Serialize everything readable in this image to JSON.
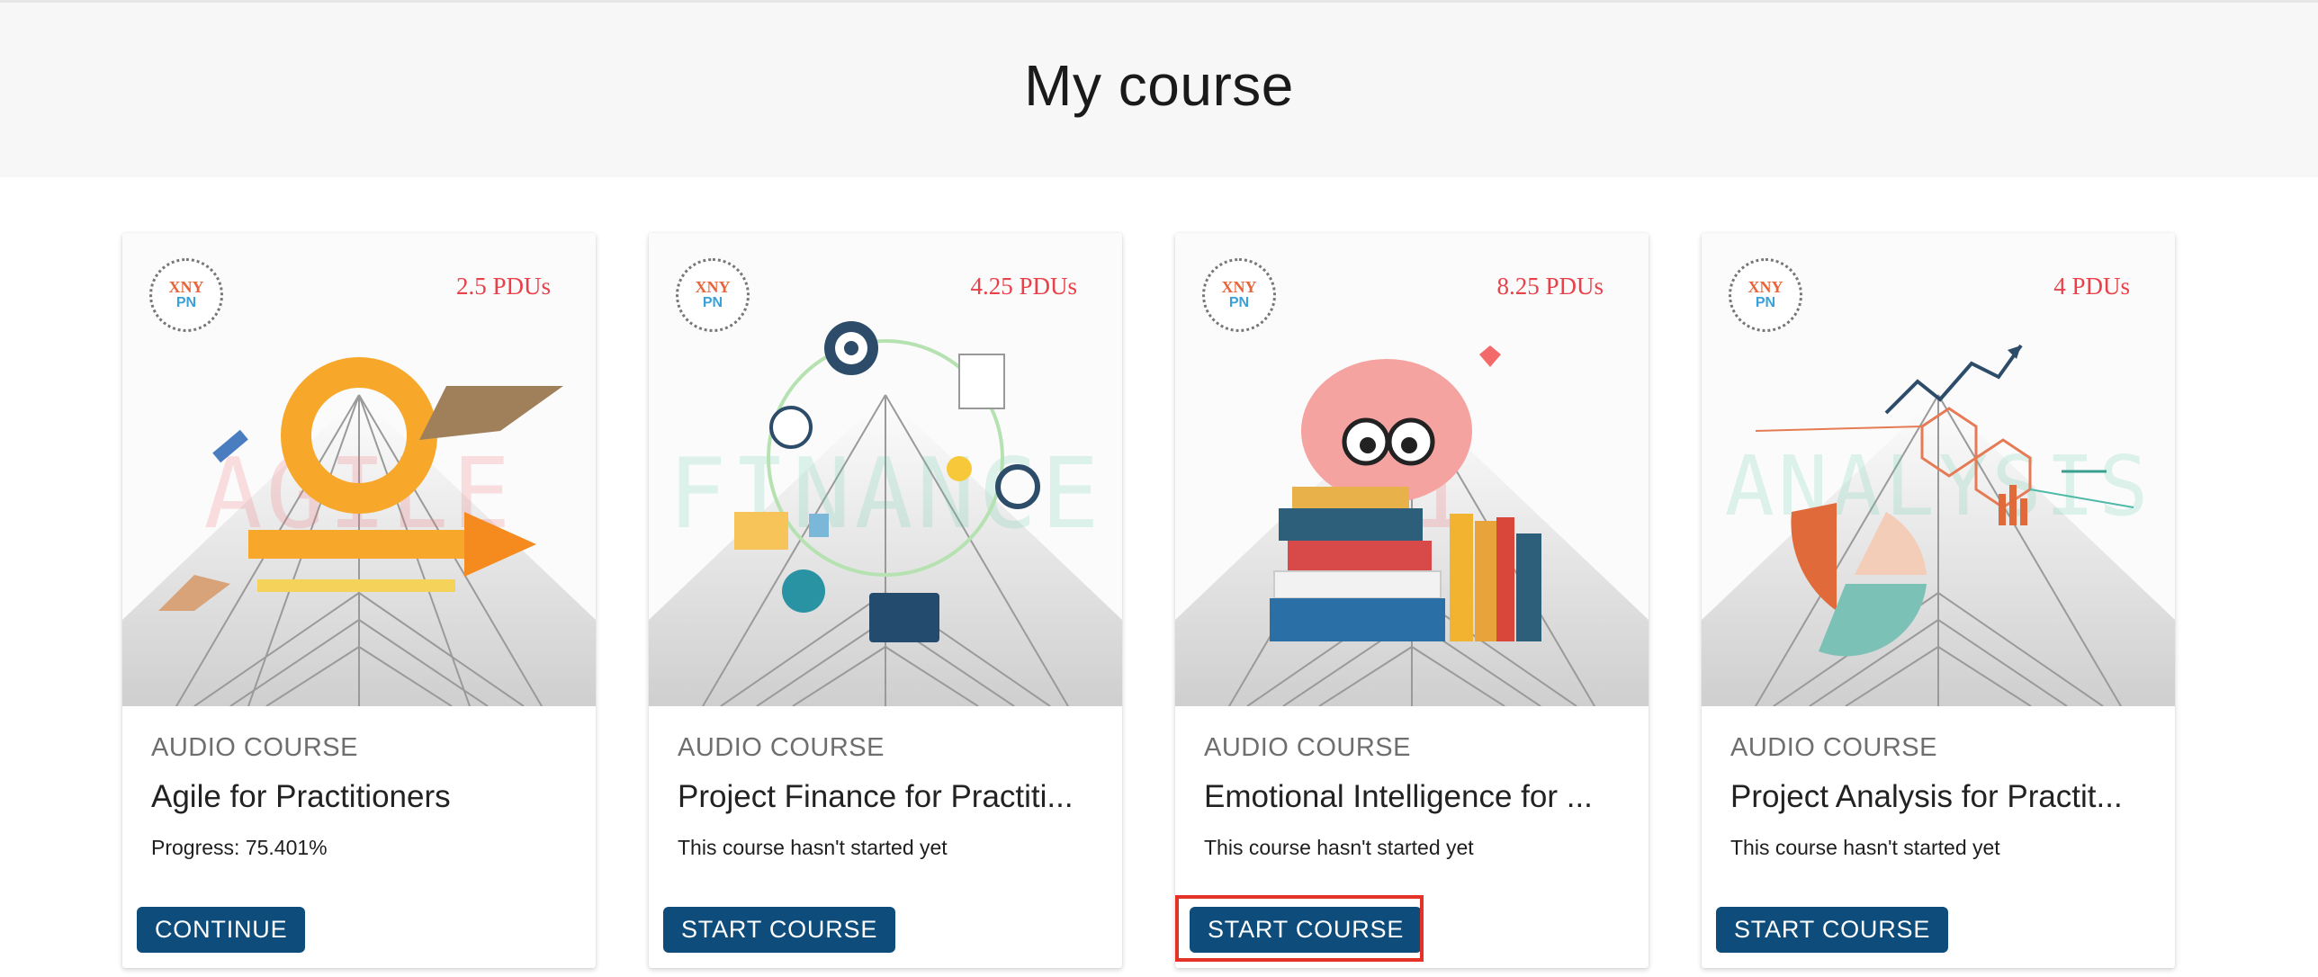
{
  "header": {
    "title": "My course"
  },
  "logo": {
    "text_top": "XNY",
    "text_bottom": "PN"
  },
  "courses": [
    {
      "pdus": "2.5 PDUs",
      "watermark": "AGILE",
      "type": "AUDIO COURSE",
      "title": "Agile for Practitioners",
      "status": "Progress: 75.401%",
      "progress_percent": 75.401,
      "button": "CONTINUE"
    },
    {
      "pdus": "4.25 PDUs",
      "watermark": "FINANCE",
      "type": "AUDIO COURSE",
      "title": "Project Finance for Practiti...",
      "status": "This course hasn't started yet",
      "button": "START COURSE"
    },
    {
      "pdus": "8.25 PDUs",
      "watermark": "EI",
      "type": "AUDIO COURSE",
      "title": "Emotional Intelligence for ...",
      "status": "This course hasn't started yet",
      "button": "START COURSE"
    },
    {
      "pdus": "4 PDUs",
      "watermark": "ANALYSIS",
      "type": "AUDIO COURSE",
      "title": "Project Analysis for Practit...",
      "status": "This course hasn't started yet",
      "button": "START COURSE"
    }
  ],
  "colors": {
    "button": "#0e4d7b",
    "pdus": "#e8414a",
    "focus": "#e53228"
  }
}
